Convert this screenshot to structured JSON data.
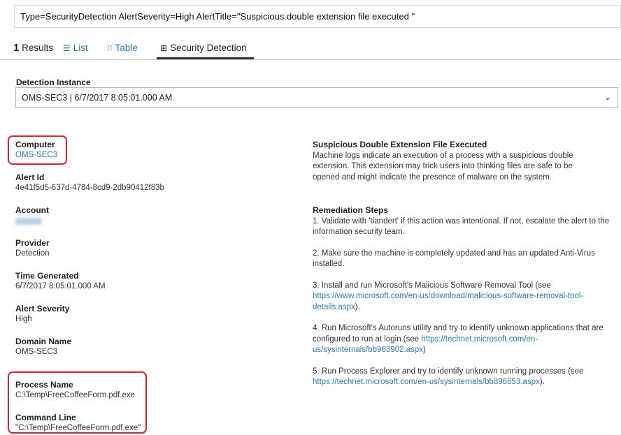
{
  "query": "Type=SecurityDetection AlertSeverity=High AlertTitle=\"Suspicious double extension file executed \"",
  "results": {
    "count": "1",
    "label": "Results"
  },
  "tabs": [
    {
      "label": "List",
      "icon": "list-icon"
    },
    {
      "label": "Table",
      "icon": "table-icon"
    },
    {
      "label": "Security Detection",
      "icon": "grid-icon"
    }
  ],
  "detection": {
    "label": "Detection Instance",
    "selected": "OMS-SEC3 | 6/7/2017 8:05:01.000 AM"
  },
  "fields": {
    "computer": {
      "label": "Computer",
      "value": "OMS-SEC3"
    },
    "alert_id": {
      "label": "Alert Id",
      "value": "4e41f5d5-637d-4784-8cd9-2db90412f83b"
    },
    "account": {
      "label": "Account"
    },
    "provider": {
      "label": "Provider",
      "value": "Detection"
    },
    "time_generated": {
      "label": "Time Generated",
      "value": "6/7/2017 8:05:01.000 AM"
    },
    "alert_severity": {
      "label": "Alert Severity",
      "value": "High"
    },
    "domain_name": {
      "label": "Domain Name",
      "value": "OMS-SEC3"
    },
    "process_name": {
      "label": "Process Name",
      "value": "C:\\Temp\\FreeCoffeeForm.pdf.exe"
    },
    "command_line": {
      "label": "Command Line",
      "value": "\"C:\\Temp\\FreeCoffeeForm.pdf.exe\""
    }
  },
  "description": {
    "title": "Suspicious Double Extension File Executed",
    "text": "Machine logs indicate an execution of a process with a suspicious double extension. This extension may trick users into thinking files are safe to be opened and might indicate the presence of malware on the system."
  },
  "remediation": {
    "title": "Remediation Steps",
    "step1": "1. Validate with 'tiandert' if this action was intentional. If not, escalate the alert to the information security team.",
    "step2": "2. Make sure the machine is completely updated and has an updated Anti-Virus installed.",
    "step3_text": "3. Install and run Microsoft's Malicious Software Removal Tool (see",
    "step3_link": "https://www.microsoft.com/en-us/download/malicious-software-removal-tool-details.aspx",
    "step3_end": ").",
    "step4_text": "4. Run Microsoft's Autoruns utility and try to identify unknown applications that are configured to run at login (see",
    "step4_link": "https://technet.microsoft.com/en-us/sysinternals/bb963902.aspx",
    "step4_end": ")",
    "step5_text": "5. Run Process Explorer and try to identify unknown running processes (see",
    "step5_link": "https://technet.microsoft.com/en-us/sysinternals/bb896653.aspx",
    "step5_end": ")."
  },
  "colors": {
    "link": "#2b7bbf",
    "highlight": "#e0242a"
  }
}
